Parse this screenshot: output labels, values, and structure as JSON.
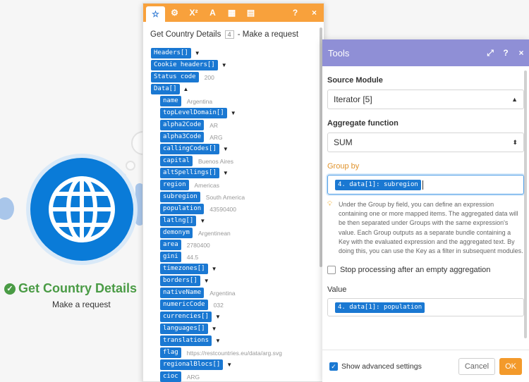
{
  "module": {
    "title": "Get Country Details",
    "subtitle": "Make a request",
    "color": "#0a7bd8",
    "icon": "globe-icon"
  },
  "mapper": {
    "title_prefix": "Get Country Details",
    "module_number": "4",
    "title_suffix": "- Make a request",
    "tabs": [
      "star-icon",
      "gear-icon",
      "superscript-icon",
      "text-icon",
      "calendar-icon",
      "table-icon"
    ],
    "help": "?",
    "close": "×",
    "items": [
      {
        "label": "Headers[]",
        "caret": "▼",
        "value": ""
      },
      {
        "label": "Cookie headers[]",
        "caret": "▼",
        "value": ""
      },
      {
        "label": "Status code",
        "caret": "",
        "value": "200"
      },
      {
        "label": "Data[]",
        "caret": "▲",
        "value": ""
      },
      {
        "label": "name",
        "caret": "",
        "value": "Argentina"
      },
      {
        "label": "topLevelDomain[]",
        "caret": "▼",
        "value": ""
      },
      {
        "label": "alpha2Code",
        "caret": "",
        "value": "AR"
      },
      {
        "label": "alpha3Code",
        "caret": "",
        "value": "ARG"
      },
      {
        "label": "callingCodes[]",
        "caret": "▼",
        "value": ""
      },
      {
        "label": "capital",
        "caret": "",
        "value": "Buenos Aires"
      },
      {
        "label": "altSpellings[]",
        "caret": "▼",
        "value": ""
      },
      {
        "label": "region",
        "caret": "",
        "value": "Americas"
      },
      {
        "label": "subregion",
        "caret": "",
        "value": "South America"
      },
      {
        "label": "population",
        "caret": "",
        "value": "43590400"
      },
      {
        "label": "latlng[]",
        "caret": "▼",
        "value": ""
      },
      {
        "label": "demonym",
        "caret": "",
        "value": "Argentinean"
      },
      {
        "label": "area",
        "caret": "",
        "value": "2780400"
      },
      {
        "label": "gini",
        "caret": "",
        "value": "44.5"
      },
      {
        "label": "timezones[]",
        "caret": "▼",
        "value": ""
      },
      {
        "label": "borders[]",
        "caret": "▼",
        "value": ""
      },
      {
        "label": "nativeName",
        "caret": "",
        "value": "Argentina"
      },
      {
        "label": "numericCode",
        "caret": "",
        "value": "032"
      },
      {
        "label": "currencies[]",
        "caret": "▼",
        "value": ""
      },
      {
        "label": "languages[]",
        "caret": "▼",
        "value": ""
      },
      {
        "label": "translations",
        "caret": "▼",
        "value": ""
      },
      {
        "label": "flag",
        "caret": "",
        "value": "https://restcountries.eu/data/arg.svg"
      },
      {
        "label": "regionalBlocs[]",
        "caret": "▼",
        "value": ""
      },
      {
        "label": "cioc",
        "caret": "",
        "value": "ARG"
      }
    ]
  },
  "tools": {
    "title": "Tools",
    "header_color": "#8f8fd6",
    "header_icons": [
      "expand-icon",
      "help-icon",
      "close-icon"
    ],
    "help": "?",
    "close": "×",
    "expand": "⤢",
    "source_label": "Source Module",
    "source_value": "Iterator [5]",
    "aggregate_label": "Aggregate function",
    "aggregate_value": "SUM",
    "group_label": "Group by",
    "group_value": "4. data[1]: subregion",
    "hint": "Under the Group by field, you can define an expression containing one or more mapped items. The aggregated data will be then separated under Groups with the same expression's value. Each Group outputs as a separate bundle containing a Key with the evaluated expression and the aggregated text. By doing this, you can use the Key as a filter in subsequent modules.",
    "stop_label": "Stop processing after an empty aggregation",
    "value_label": "Value",
    "value_value": "4. data[1]: population",
    "advanced_label": "Show advanced settings",
    "cancel": "Cancel",
    "ok": "OK",
    "ok_color": "#f39a2b"
  }
}
